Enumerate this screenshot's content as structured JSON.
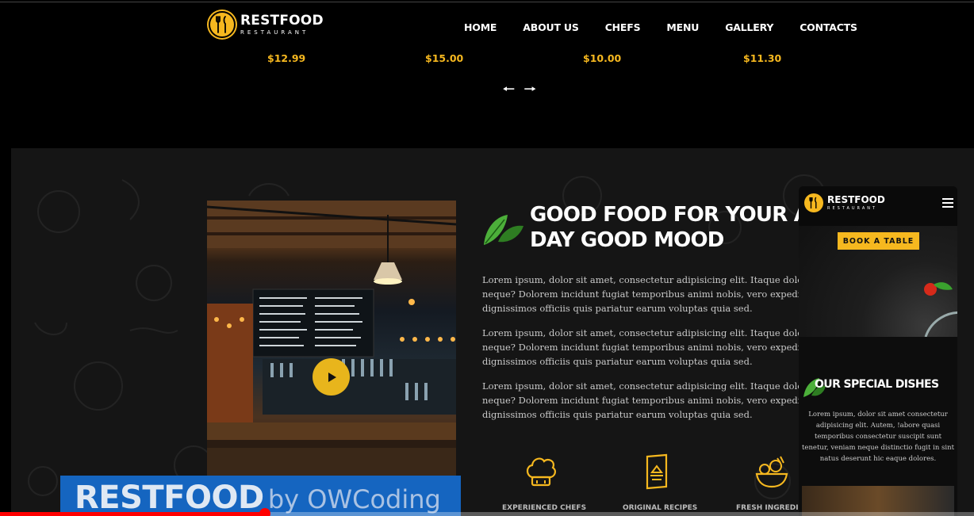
{
  "colors": {
    "accent": "#f6b81f",
    "background": "#000000",
    "section_bg": "#151515",
    "banner": "#1565c0",
    "progress": "#ff0000"
  },
  "brand": {
    "name": "RESTFOOD",
    "sub": "RESTAURANT"
  },
  "nav": [
    "HOME",
    "ABOUT US",
    "CHEFS",
    "MENU",
    "GALLERY",
    "CONTACTS"
  ],
  "prices": [
    "$12.99",
    "$15.00",
    "$10.00",
    "$11.30"
  ],
  "slider": {
    "prev": "🠐",
    "next": "🠒"
  },
  "about": {
    "heading_line1": "GOOD FOOD FOR YOUR AI",
    "heading_line2": "DAY GOOD MOOD",
    "paragraphs": [
      {
        "l1": "Lorem ipsum, dolor sit amet, consectetur adipisicing elit. Itaque dolore nisi ips",
        "l2": "neque? Dolorem incidunt fugiat temporibus animi nobis, vero expedita voluptat",
        "l3": "dignissimos officiis quis pariatur earum voluptas quia sed."
      },
      {
        "l1": "Lorem ipsum, dolor sit amet, consectetur adipisicing elit. Itaque dolore nisi ips",
        "l2": "neque? Dolorem incidunt fugiat temporibus animi nobis, vero expedita voluptat",
        "l3": "dignissimos officiis quis pariatur earum voluptas quia sed."
      },
      {
        "l1": "Lorem ipsum, dolor sit amet, consectetur adipisicing elit. Itaque dolore nisi ips",
        "l2": "neque? Dolorem incidunt fugiat temporibus animi nobis, vero expedita voluptat",
        "l3": "dignissimos officiis quis pariatur earum voluptas quia sed."
      }
    ],
    "features": [
      "EXPERIENCED CHEFS",
      "ORIGINAL RECIPES",
      "FRESH INGREDIEN"
    ],
    "feature_icons": [
      "chef-hat-icon",
      "recipe-book-icon",
      "vegetables-basket-icon"
    ]
  },
  "mobile": {
    "name": "RESTFOOD",
    "sub": "RESTAURANT",
    "book_button": "BOOK A TABLE",
    "section_title": "OUR SPECIAL DISHES",
    "section_text": "Lorem ipsum, dolor sit amet consectetur adipisicing elit. Autem, !abore quasi temporibus consectetur suscipit sunt tenetur, veniam neque distinctio fugit in sint natus deserunt hic eaque dolores."
  },
  "banner": {
    "brand": "RESTFOOD",
    "by": "by OWCoding"
  },
  "video": {
    "progress_fraction": 0.272
  }
}
